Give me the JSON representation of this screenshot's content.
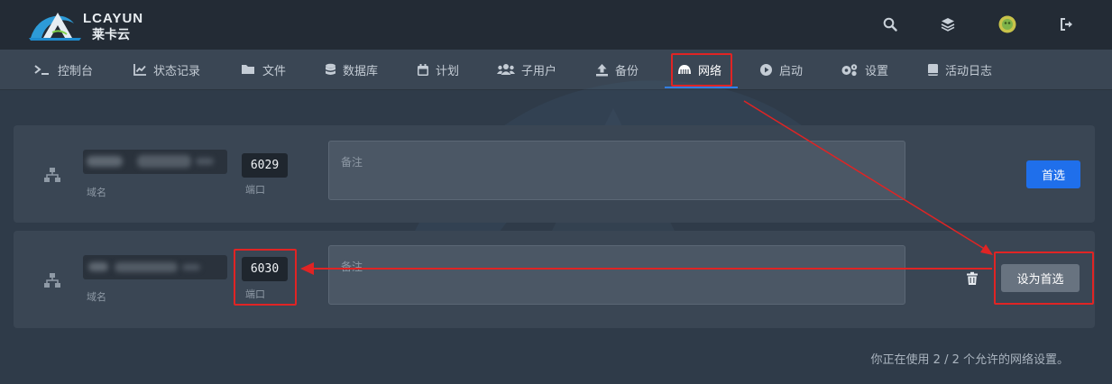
{
  "header": {
    "brand": "LCAYUN",
    "brand_cn": "莱卡云",
    "icons": [
      "search-icon",
      "layers-icon",
      "avatar",
      "logout-icon"
    ]
  },
  "nav": {
    "items": [
      {
        "label": "控制台",
        "icon": "terminal-icon"
      },
      {
        "label": "状态记录",
        "icon": "chart-icon"
      },
      {
        "label": "文件",
        "icon": "folder-icon"
      },
      {
        "label": "数据库",
        "icon": "database-icon"
      },
      {
        "label": "计划",
        "icon": "calendar-icon"
      },
      {
        "label": "子用户",
        "icon": "users-icon"
      },
      {
        "label": "备份",
        "icon": "upload-icon"
      },
      {
        "label": "网络",
        "icon": "network-icon",
        "active": true
      },
      {
        "label": "启动",
        "icon": "play-icon"
      },
      {
        "label": "设置",
        "icon": "cogs-icon"
      },
      {
        "label": "活动日志",
        "icon": "book-icon"
      }
    ]
  },
  "allocations": [
    {
      "domain_label": "域名",
      "port": "6029",
      "port_label": "端口",
      "note_placeholder": "备注",
      "action_label": "首选",
      "primary": true
    },
    {
      "domain_label": "域名",
      "port": "6030",
      "port_label": "端口",
      "note_placeholder": "备注",
      "action_label": "设为首选",
      "primary": false
    }
  ],
  "footer": {
    "usage_text": "你正在使用 2 / 2 个允许的网络设置。"
  },
  "colors": {
    "accent": "#1f6feb",
    "annotation": "#e02424",
    "panel": "#3a4654",
    "background": "#2f3b49"
  }
}
